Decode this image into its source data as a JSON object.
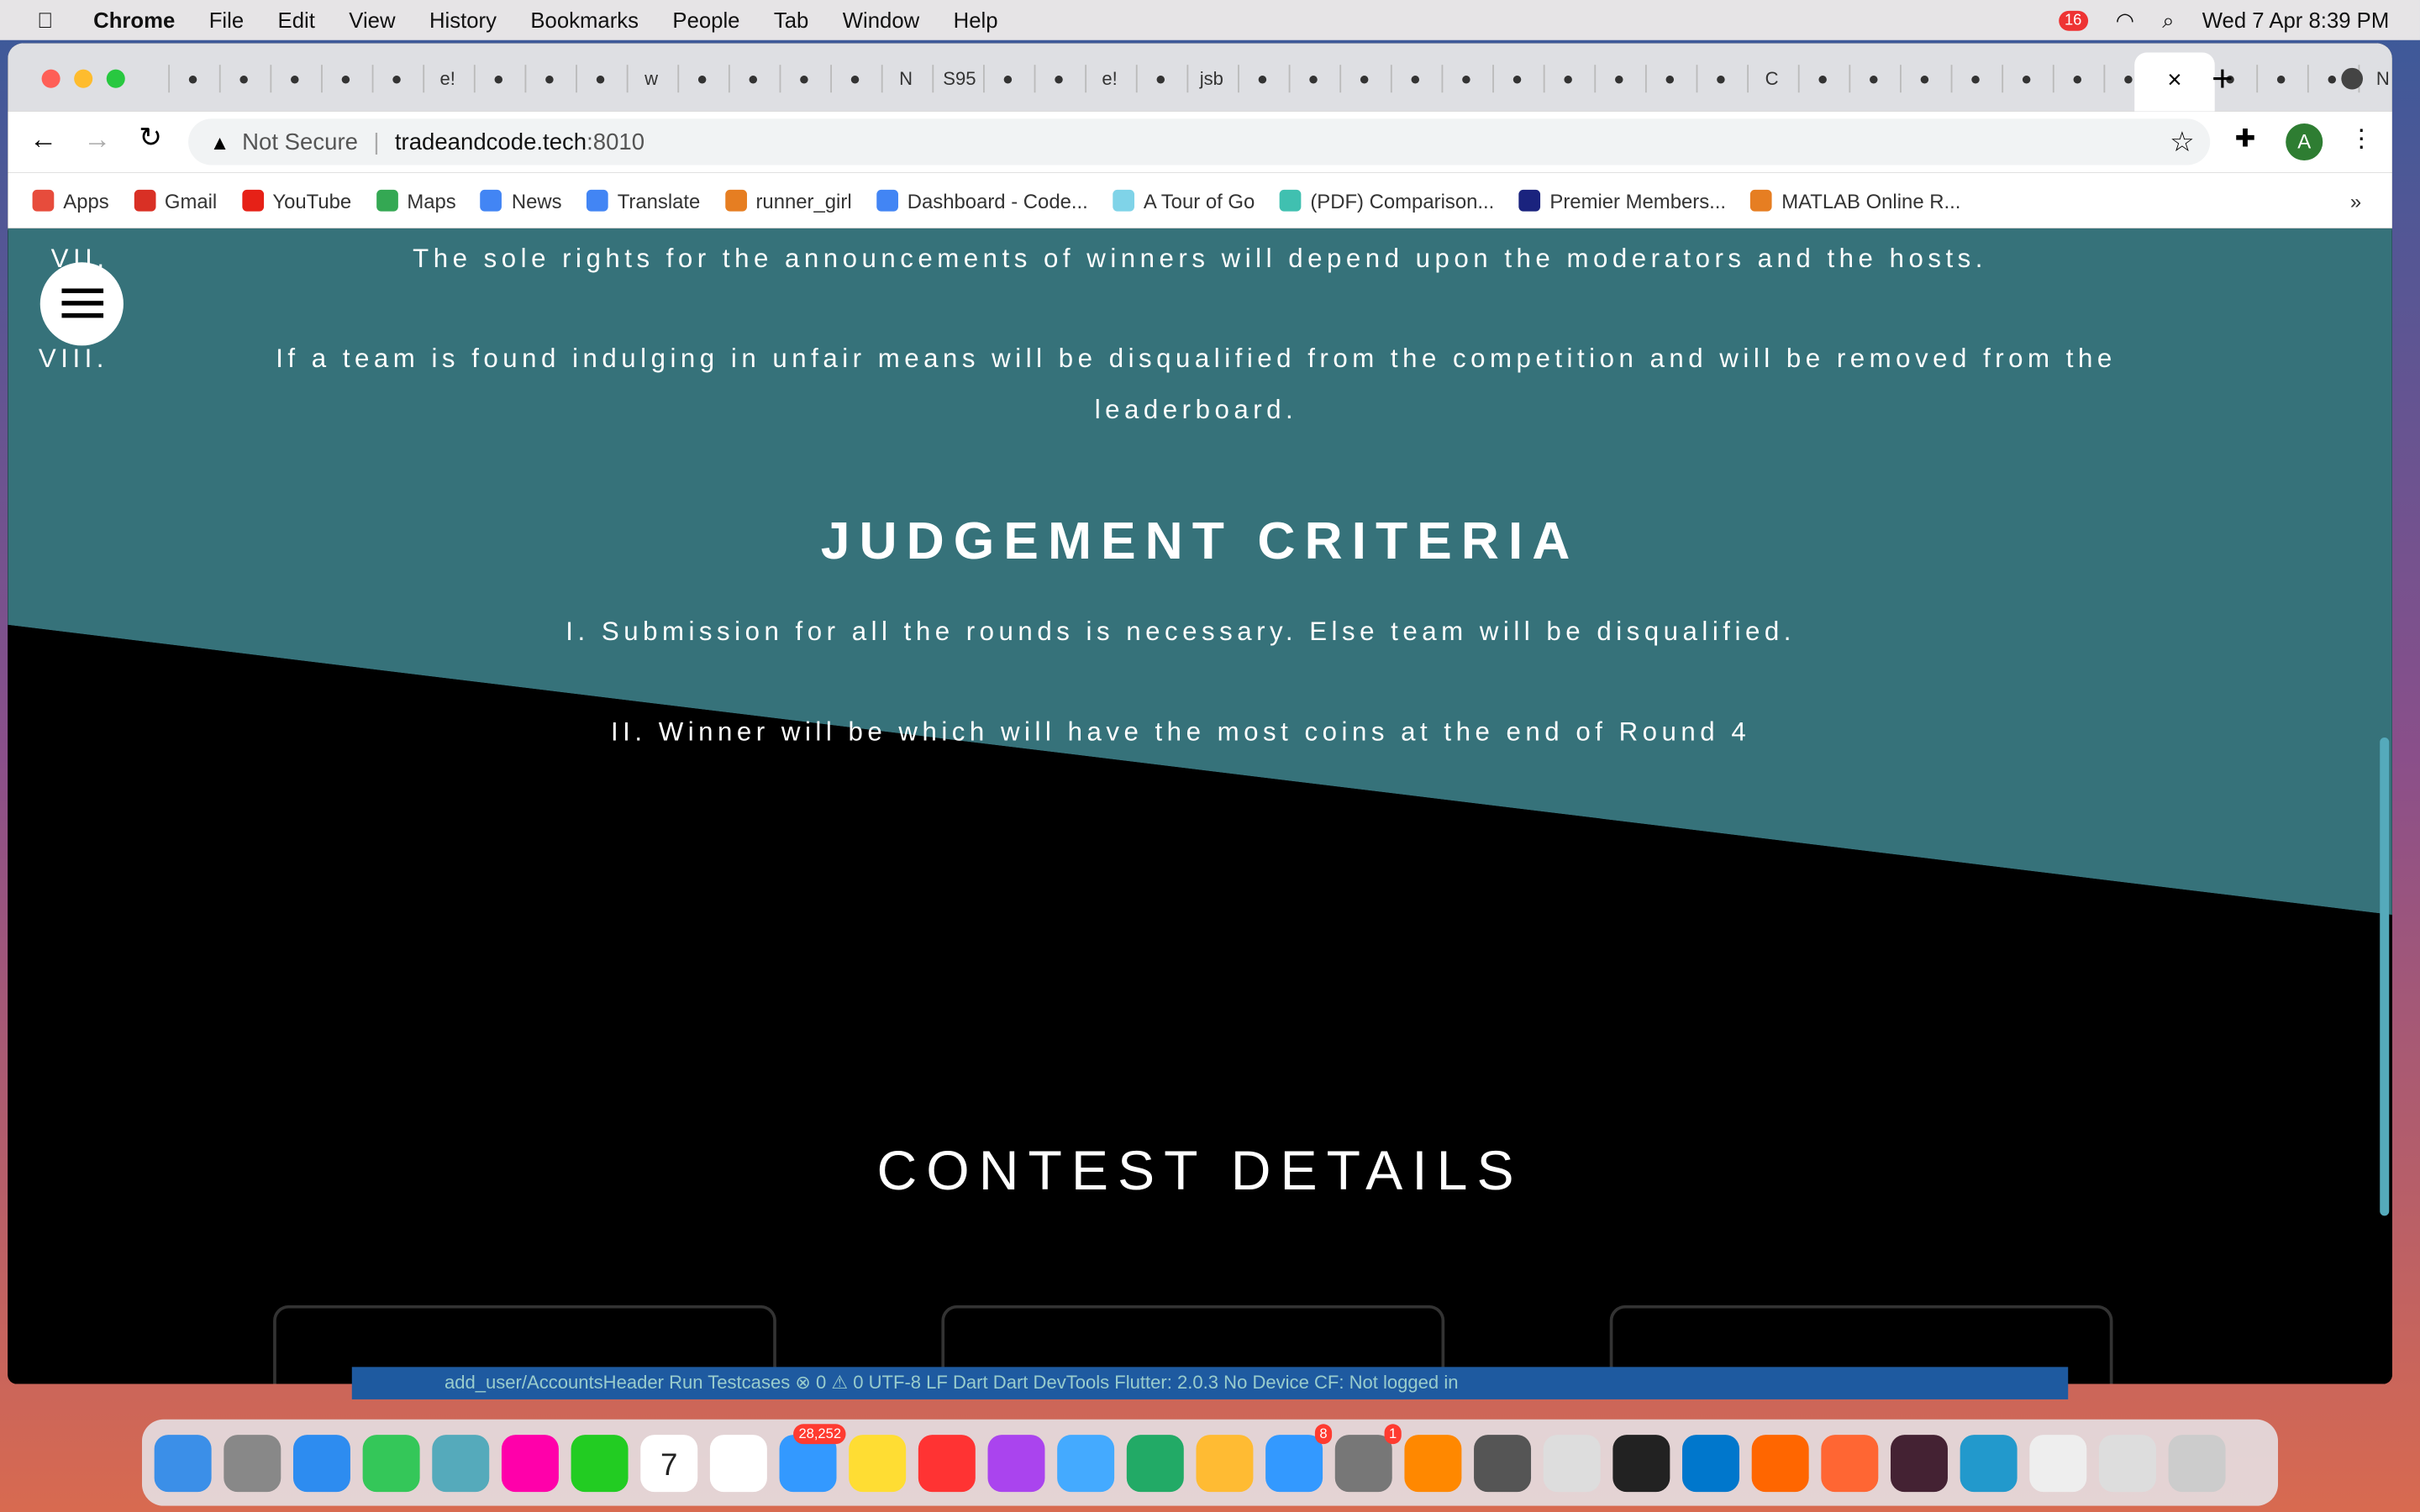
{
  "menubar": {
    "app": "Chrome",
    "items": [
      "File",
      "Edit",
      "View",
      "History",
      "Bookmarks",
      "People",
      "Tab",
      "Window",
      "Help"
    ],
    "clock": "Wed 7 Apr  8:39 PM",
    "badge": "16"
  },
  "tabs": {
    "favicons": [
      "sync",
      "github",
      "sync",
      "stackoverflow",
      "docker",
      "e!",
      "globe",
      "stackoverflow",
      "stackoverflow",
      "w",
      "github",
      "github",
      "stackoverflow",
      "github",
      "N",
      "S95",
      "globe",
      "diamond",
      "e!",
      "github",
      "jsb",
      "edge",
      "stackoverflow",
      "matlab",
      "globe",
      "code",
      "edge",
      "stackoverflow",
      "link",
      "speaker",
      "list",
      "C",
      "list",
      "drive",
      "drive",
      "bird",
      "github",
      "github",
      "stackoverflow",
      "globe",
      "github",
      "diamond",
      "play",
      "N",
      "sync",
      "N",
      "G",
      "diamond"
    ],
    "close": "×",
    "new_tab": "+"
  },
  "toolbar": {
    "security": "Not Secure",
    "url": "tradeandcode.tech",
    "port": ":8010",
    "profile": "A"
  },
  "bookmarks": [
    {
      "label": "Apps",
      "color": "#e74c3c"
    },
    {
      "label": "Gmail",
      "color": "#d93025"
    },
    {
      "label": "YouTube",
      "color": "#e62117"
    },
    {
      "label": "Maps",
      "color": "#34a853"
    },
    {
      "label": "News",
      "color": "#4285f4"
    },
    {
      "label": "Translate",
      "color": "#4285f4"
    },
    {
      "label": "runner_girl",
      "color": "#e67e22"
    },
    {
      "label": "Dashboard - Code...",
      "color": "#4285f4"
    },
    {
      "label": "A Tour of Go",
      "color": "#7fd3e8"
    },
    {
      "label": "(PDF) Comparison...",
      "color": "#40c0b0"
    },
    {
      "label": "Premier Members...",
      "color": "#1a237e"
    },
    {
      "label": "MATLAB Online R...",
      "color": "#e67e22"
    }
  ],
  "bookmarks_more": "»",
  "page": {
    "rule7_num": "VII.",
    "rule7": "The sole rights for the announcements of winners will depend upon the moderators and the hosts.",
    "rule8_num": "VIII.",
    "rule8a": "If a team is found indulging in unfair means will be disqualified from the competition and will be removed from the",
    "rule8b": "leaderboard.",
    "judgement_title": "JUDGEMENT CRITERIA",
    "crit1": "I. Submission for all the rounds is necessary. Else team will be disqualified.",
    "crit2": "II. Winner will be which will have the most coins at the end of Round 4",
    "contest_title": "CONTEST DETAILS",
    "bg_color": "#36727a"
  },
  "vscode_status": "add_user/AccountsHeader   Run Testcases   ⊗ 0 ⚠ 0   UTF-8   LF   Dart   Dart DevTools   Flutter: 2.0.3   No Device   CF: Not logged in",
  "dock": {
    "badges": {
      "calendar": "7",
      "mail": "28,252",
      "appstore": "8",
      "settings": "1"
    }
  }
}
